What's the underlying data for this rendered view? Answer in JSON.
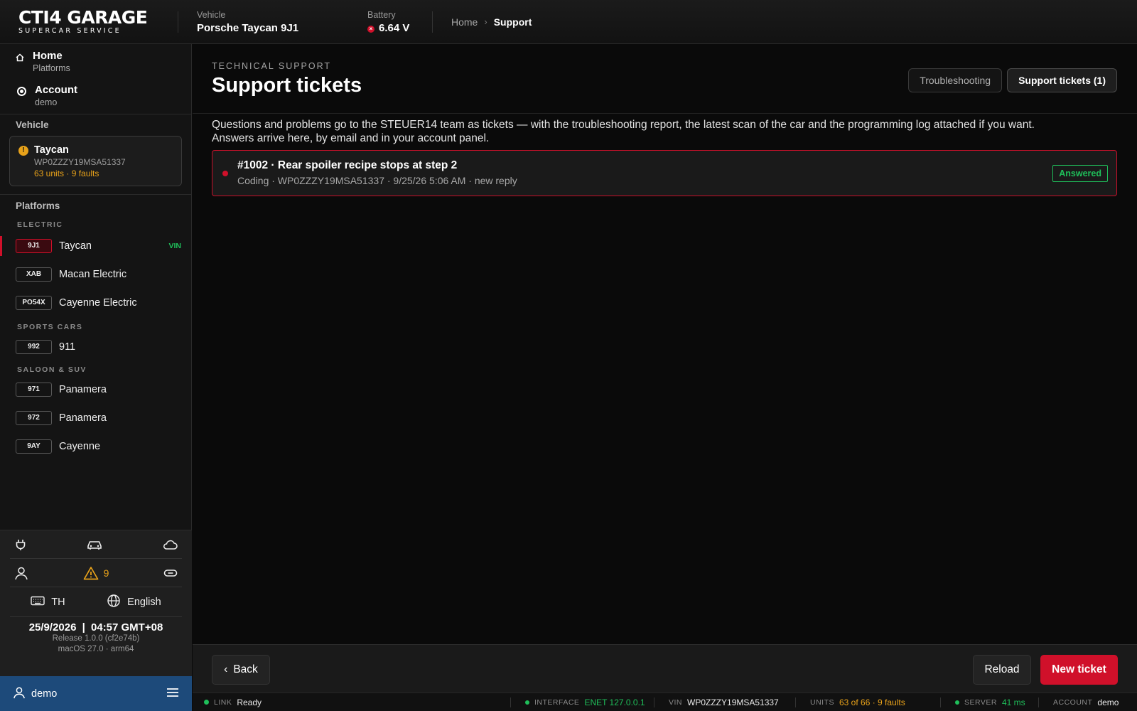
{
  "app": {
    "logo_main": "CTI4 GARAGE",
    "logo_sub": "SUPERCAR SERVICE"
  },
  "topbar": {
    "vehicle_label": "Vehicle",
    "vehicle_value": "Porsche Taycan 9J1",
    "battery_label": "Battery",
    "battery_value": "6.64 V",
    "battery_status_color": "#d0102a",
    "breadcrumb": {
      "home": "Home",
      "separator": "›",
      "current": "Support"
    }
  },
  "sidebar": {
    "nav": [
      {
        "title": "Home",
        "sub": "Platforms",
        "icon": "home-icon"
      },
      {
        "title": "Account",
        "sub": "demo",
        "icon": "radio-icon"
      }
    ],
    "vehicle_section": "Vehicle",
    "vehicle_card": {
      "name": "Taycan",
      "vin": "WP0ZZZY19MSA51337",
      "stats": "63 units · 9 faults",
      "warn_symbol": "!"
    },
    "platforms_section": "Platforms",
    "groups": [
      {
        "label": "ELECTRIC",
        "items": [
          {
            "code": "9J1",
            "name": "Taycan",
            "tag": "VIN",
            "active": true
          },
          {
            "code": "XAB",
            "name": "Macan Electric",
            "tag": ""
          },
          {
            "code": "PO54X",
            "name": "Cayenne Electric",
            "tag": ""
          }
        ]
      },
      {
        "label": "SPORTS CARS",
        "items": [
          {
            "code": "992",
            "name": "911",
            "tag": ""
          }
        ]
      },
      {
        "label": "SALOON & SUV",
        "items": [
          {
            "code": "971",
            "name": "Panamera",
            "tag": ""
          },
          {
            "code": "972",
            "name": "Panamera",
            "tag": ""
          },
          {
            "code": "9AY",
            "name": "Cayenne",
            "tag": ""
          }
        ]
      }
    ],
    "bottom": {
      "fault_count": "9",
      "keyboard": "TH",
      "language": "English",
      "date": "25/9/2026",
      "time": "04:57 GMT+08",
      "release": "Release 1.0.0 (cf2e74b)",
      "os": "macOS 27.0 · arm64",
      "user": "demo"
    }
  },
  "main": {
    "eyebrow": "TECHNICAL SUPPORT",
    "title": "Support tickets",
    "tabs": [
      {
        "label": "Troubleshooting",
        "active": false
      },
      {
        "label": "Support tickets (1)",
        "active": true
      }
    ],
    "intro_line1": "Questions and problems go to the STEUER14 team as tickets — with the troubleshooting report, the latest scan of the car and the programming log attached if you want.",
    "intro_line2": "Answers arrive here, by email and in your account panel.",
    "tickets": [
      {
        "title": "#1002 · Rear spoiler recipe stops at step 2",
        "meta": "Coding · WP0ZZZY19MSA51337 · 9/25/26 5:06 AM · new reply",
        "status": "Answered"
      }
    ]
  },
  "actions": {
    "back": "Back",
    "back_icon": "‹",
    "reload": "Reload",
    "new_ticket": "New ticket"
  },
  "statusbar": {
    "link_key": "LINK",
    "link_value": "Ready",
    "interface_key": "INTERFACE",
    "interface_value": "ENET 127.0.0.1",
    "vin_key": "VIN",
    "vin_value": "WP0ZZZY19MSA51337",
    "units_key": "UNITS",
    "units_value": "63 of 66 · 9 faults",
    "server_key": "SERVER",
    "server_value": "41 ms",
    "account_key": "ACCOUNT",
    "account_value": "demo"
  },
  "colors": {
    "accent_red": "#d0102a",
    "ok_green": "#1fbf5a",
    "warn_orange": "#e8a21a",
    "user_bar": "#1d4a7a"
  }
}
